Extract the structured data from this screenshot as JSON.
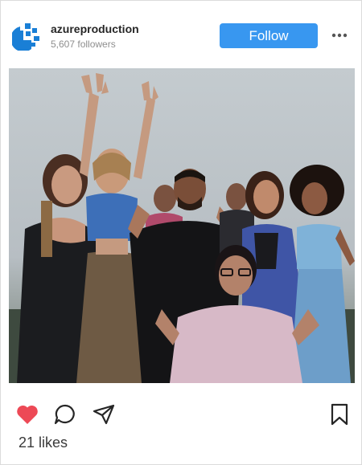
{
  "post": {
    "username": "azureproduction",
    "followers": "5,607 followers",
    "follow_label": "Follow",
    "likes": "21 likes",
    "liked": true
  },
  "icons": {
    "avatar": "azure-logo-icon",
    "more": "more-options-icon",
    "like": "heart-icon",
    "comment": "comment-icon",
    "share": "share-icon",
    "save": "bookmark-icon"
  },
  "colors": {
    "follow_button": "#3897f0",
    "like_active": "#ed4956",
    "brand_blue": "#1a7fd6"
  }
}
